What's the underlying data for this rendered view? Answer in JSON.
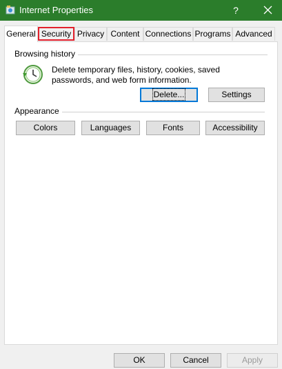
{
  "window": {
    "title": "Internet Properties",
    "help_glyph": "?"
  },
  "tabs": [
    {
      "label": "General",
      "active": true
    },
    {
      "label": "Security",
      "highlighted": true
    },
    {
      "label": "Privacy"
    },
    {
      "label": "Content"
    },
    {
      "label": "Connections"
    },
    {
      "label": "Programs"
    },
    {
      "label": "Advanced"
    }
  ],
  "browsing_history": {
    "label": "Browsing history",
    "description": "Delete temporary files, history, cookies, saved passwords, and web form information.",
    "delete_button": "Delete...",
    "settings_button": "Settings"
  },
  "appearance": {
    "label": "Appearance",
    "buttons": [
      "Colors",
      "Languages",
      "Fonts",
      "Accessibility"
    ]
  },
  "footer": {
    "ok": "OK",
    "cancel": "Cancel",
    "apply": "Apply"
  },
  "colors": {
    "titlebar": "#2b7d2b",
    "highlight": "#e3202c",
    "focus": "#0078d7"
  }
}
